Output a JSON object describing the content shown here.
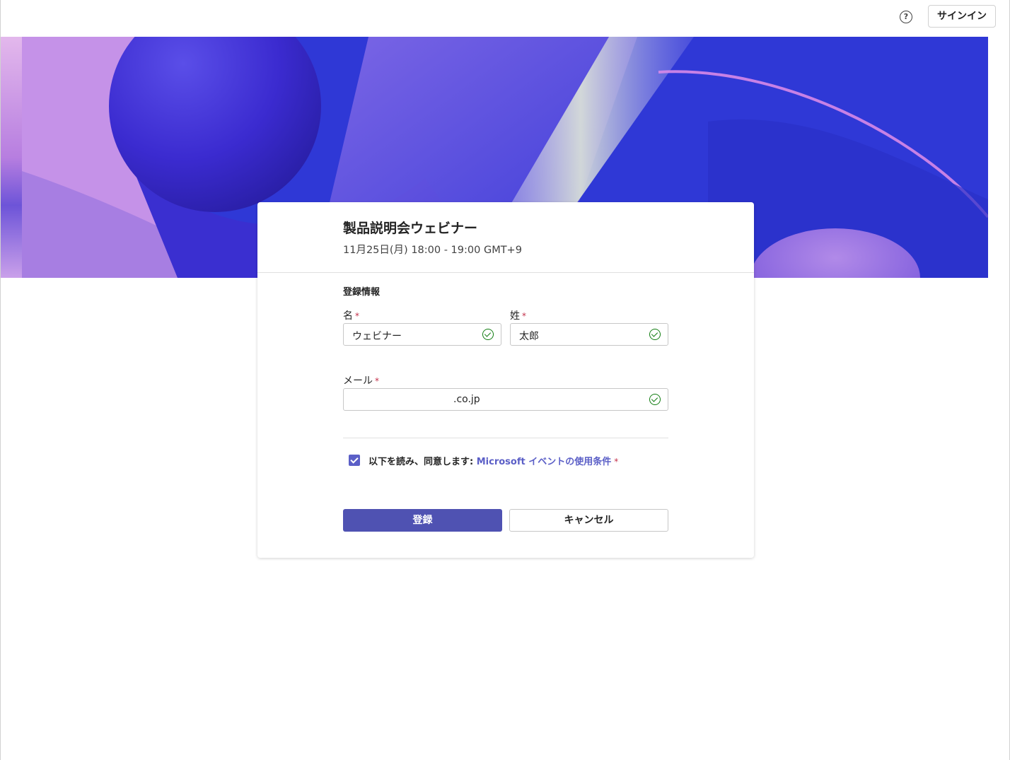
{
  "header": {
    "help_icon": "?",
    "signin_label": "サインイン"
  },
  "event": {
    "title": "製品説明会ウェビナー",
    "datetime": "11月25日(月) 18:00 - 19:00 GMT+9"
  },
  "form": {
    "section_title": "登録情報",
    "first_name": {
      "label": "名",
      "required": "*",
      "value": "ウェビナー"
    },
    "last_name": {
      "label": "姓",
      "required": "*",
      "value": "太郎"
    },
    "email": {
      "label": "メール",
      "required": "*",
      "value": ".co.jp"
    },
    "agree": {
      "checked": true,
      "text": "以下を読み、同意します: ",
      "link_text": "Microsoft イベントの使用条件",
      "required": "*"
    },
    "submit_label": "登録",
    "cancel_label": "キャンセル"
  },
  "colors": {
    "accent": "#5b5fc7",
    "primary_button": "#4f52b2",
    "success": "#107c10",
    "required": "#c4314b"
  }
}
